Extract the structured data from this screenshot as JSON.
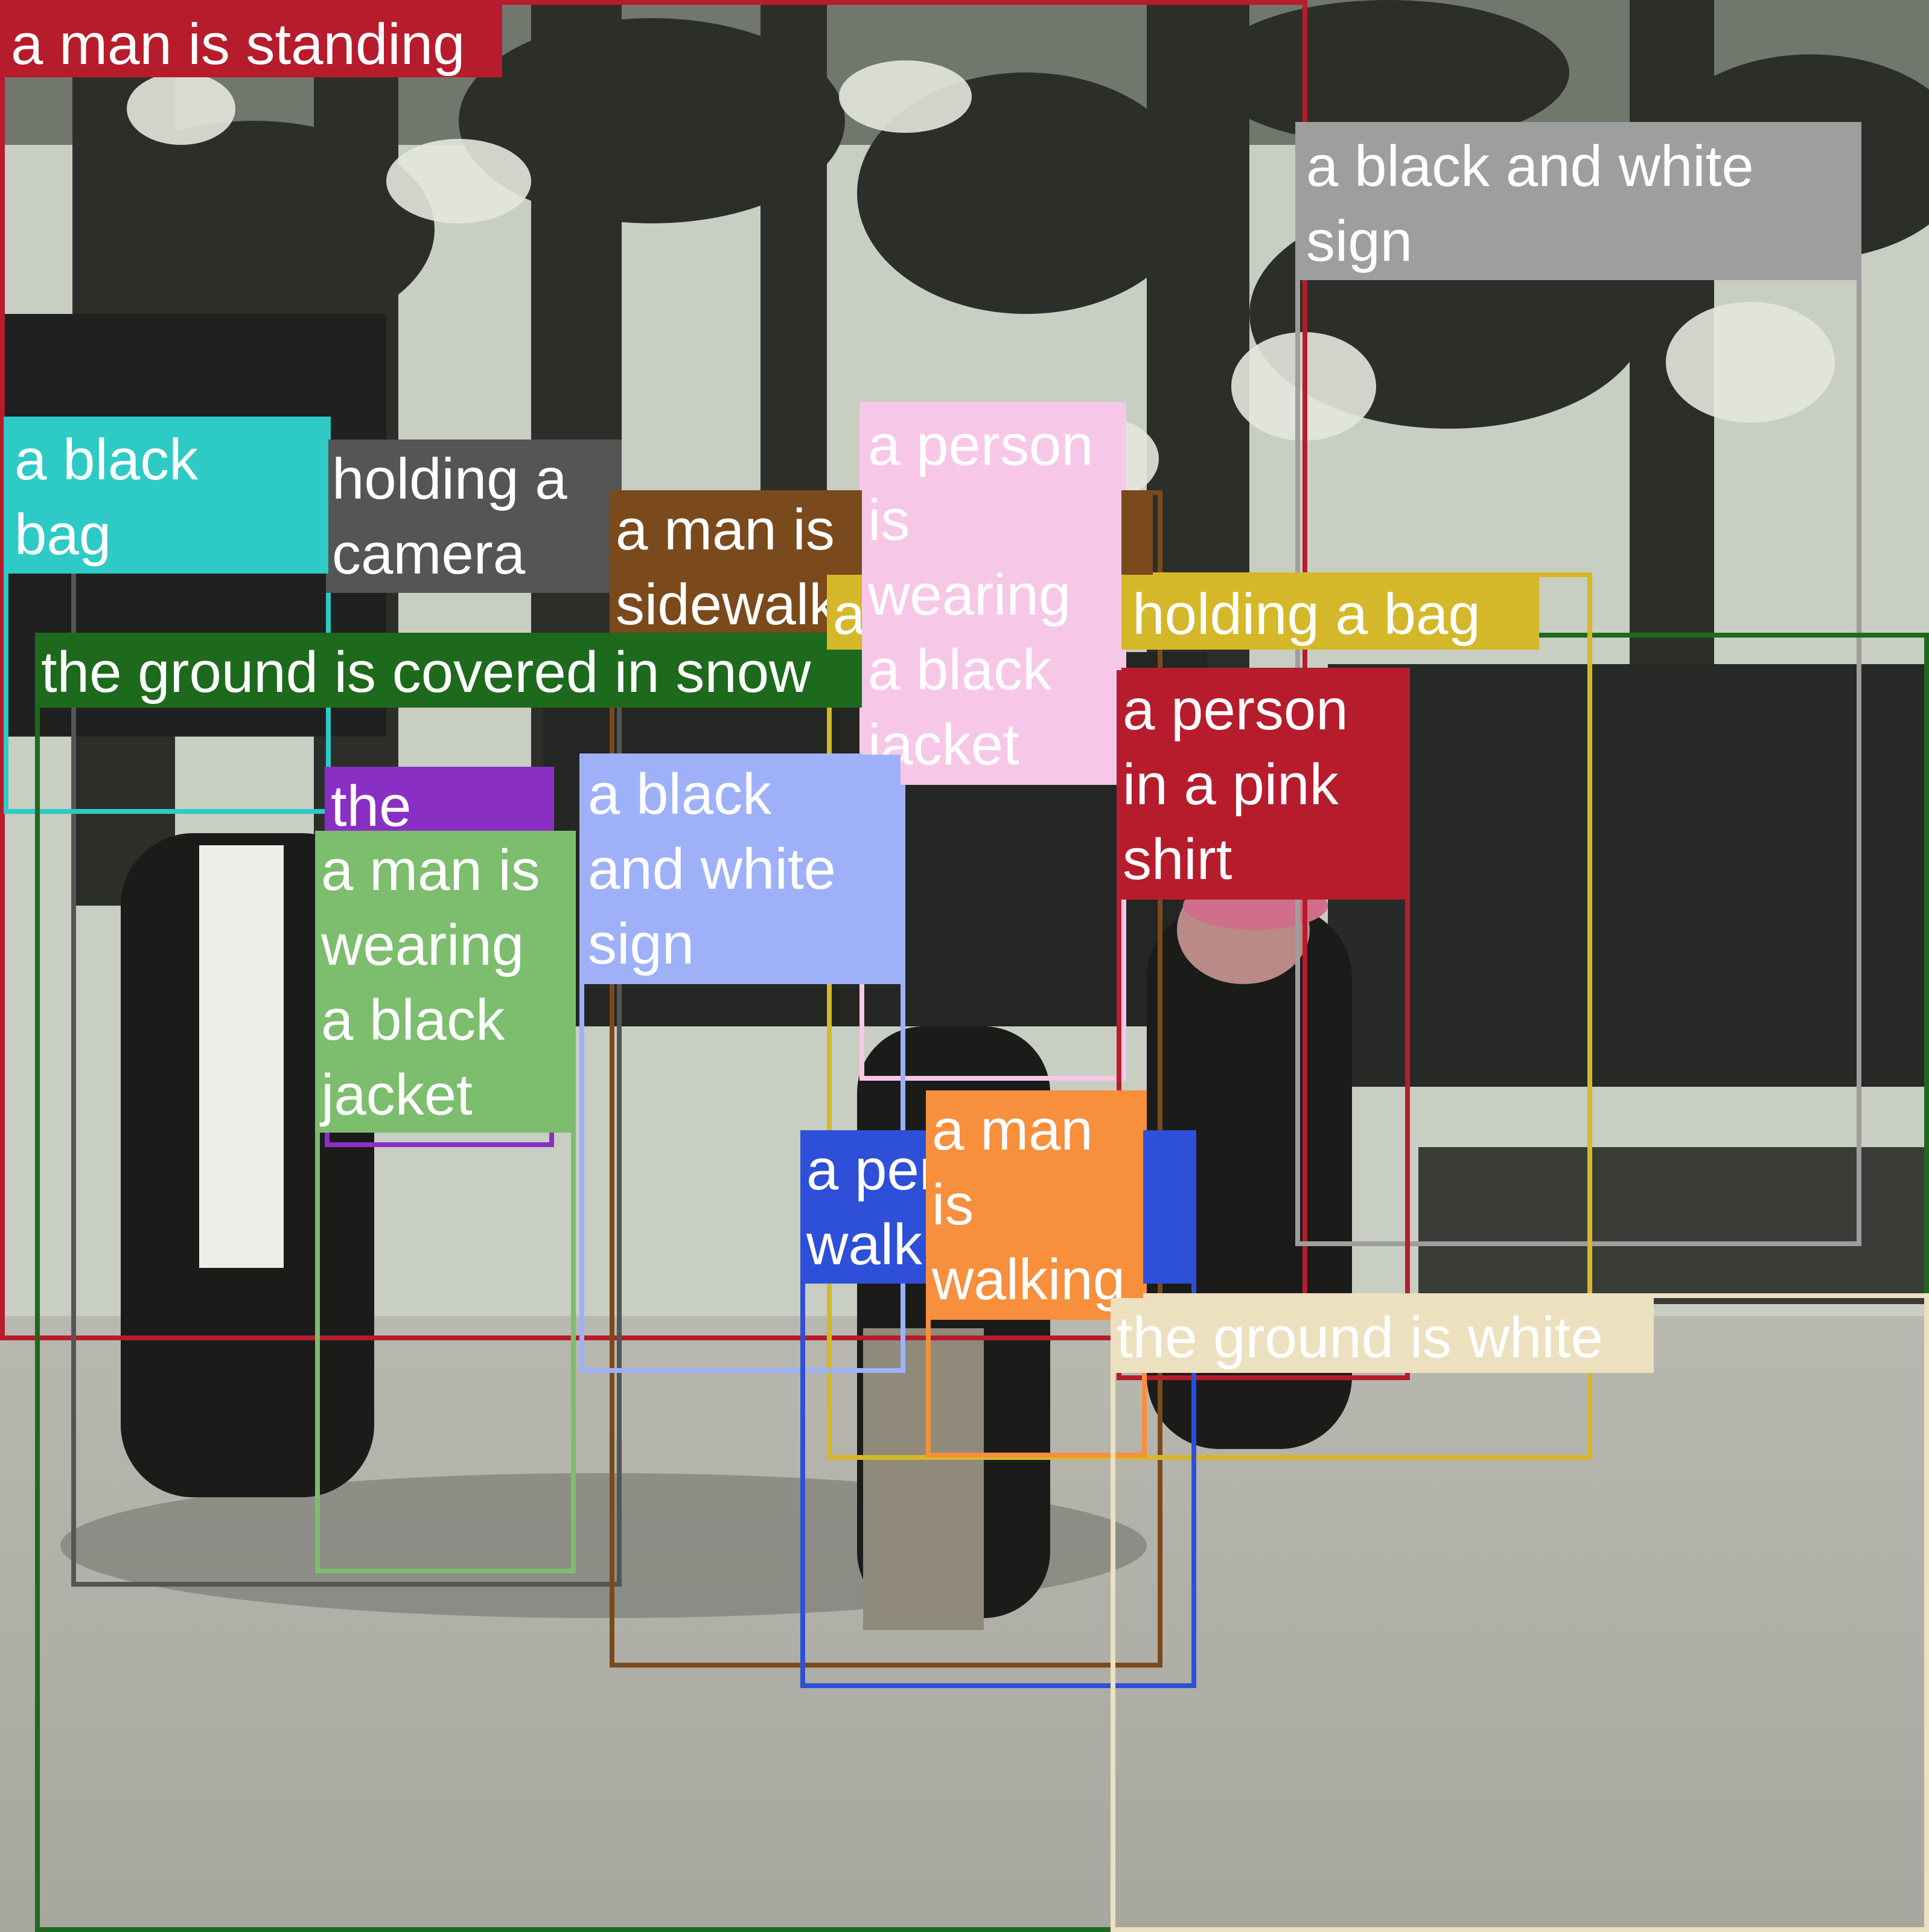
{
  "image": {
    "kind": "photo",
    "description_colors": {
      "sky_light": "#c9cfc3",
      "tree_dark": "#2b2d28",
      "ground": "#aeaea6"
    }
  },
  "regions": [
    {
      "id": "r1",
      "caption": "a man is standing",
      "color": "#b71c2c"
    },
    {
      "id": "r2",
      "caption": "a black and white\nsign",
      "color": "#9e9e9e"
    },
    {
      "id": "r3",
      "caption": "holding a\ncamera",
      "color": "#555555"
    },
    {
      "id": "r4",
      "caption": "a black\nbag",
      "color": "#2ecac6"
    },
    {
      "id": "r5",
      "caption": "a man is\nsidewalk",
      "color": "#7b4a1c"
    },
    {
      "id": "r6",
      "caption": "the ground is covered in snow",
      "color": "#1d6a1d"
    },
    {
      "id": "r7",
      "caption": "a person is holding a bag",
      "color": "#d4b82a"
    },
    {
      "id": "r8",
      "caption": "a person\nis\nwearing\na black\njacket",
      "color": "#f7c7e8"
    },
    {
      "id": "r9",
      "caption": "a person\nin a pink\nshirt",
      "color": "#b71c2c"
    },
    {
      "id": "r10",
      "caption": "the",
      "color": "#8a2fc4"
    },
    {
      "id": "r11",
      "caption": "a man is\nwearing\na black\njacket",
      "color": "#7dbd6e"
    },
    {
      "id": "r12",
      "caption": "a black\nand white\nsign",
      "color": "#9eb1f8"
    },
    {
      "id": "r13",
      "caption": "a person is\nwalking",
      "color": "#2e4fd8"
    },
    {
      "id": "r14",
      "caption": "a man\nis\nwalking",
      "color": "#f78f3c"
    },
    {
      "id": "r15",
      "caption": "the ground is white",
      "color": "#ece0bf"
    }
  ]
}
